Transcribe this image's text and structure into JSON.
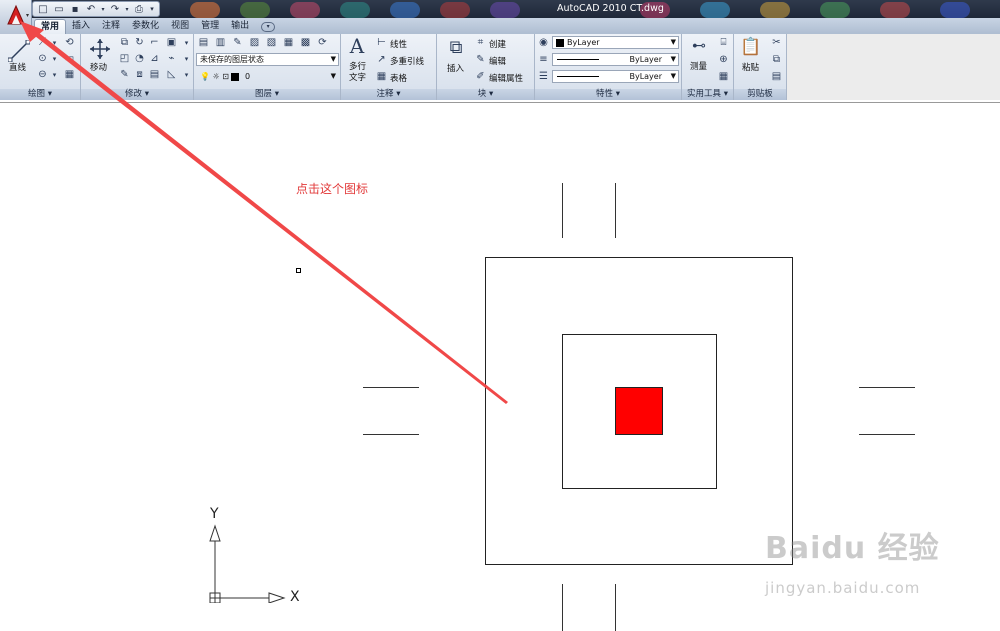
{
  "window": {
    "title": "AutoCAD 2010     CT.dwg"
  },
  "quick_access": [
    "new-file-icon",
    "open-folder-icon",
    "save-icon",
    "undo-icon",
    "redo-icon",
    "plot-icon"
  ],
  "tabs": [
    {
      "label": "常用",
      "active": true
    },
    {
      "label": "插入"
    },
    {
      "label": "注释"
    },
    {
      "label": "参数化"
    },
    {
      "label": "视图"
    },
    {
      "label": "管理"
    },
    {
      "label": "输出"
    }
  ],
  "ribbon": {
    "draw": {
      "title": "绘图",
      "line_label": "直线"
    },
    "modify": {
      "title": "修改",
      "move_label": "移动"
    },
    "layers": {
      "title": "图层",
      "layer_state": "未保存的图层状态",
      "current_layer": "0"
    },
    "annotation": {
      "title": "注释",
      "mtext_label_1": "多行",
      "mtext_label_2": "文字",
      "linear_label": "线性",
      "mleader_label": "多重引线",
      "table_label": "表格"
    },
    "block": {
      "title": "块",
      "insert_label": "插入",
      "create_label": "创建",
      "edit_label": "编辑",
      "edit_attr_label": "编辑属性"
    },
    "properties": {
      "title": "特性",
      "color": "ByLayer",
      "linetype": "ByLayer",
      "lineweight": "ByLayer"
    },
    "utilities": {
      "title": "实用工具",
      "measure_label": "测量"
    },
    "clipboard": {
      "title": "剪贴板",
      "paste_label": "粘贴"
    }
  },
  "canvas": {
    "annotation_text": "点击这个图标",
    "ucs": {
      "x_label": "X",
      "y_label": "Y"
    },
    "fill_color": "#ff0000",
    "arrow_color": "#f04848"
  },
  "watermark": {
    "brand": "Baidu 经验",
    "url": "jingyan.baidu.com"
  }
}
